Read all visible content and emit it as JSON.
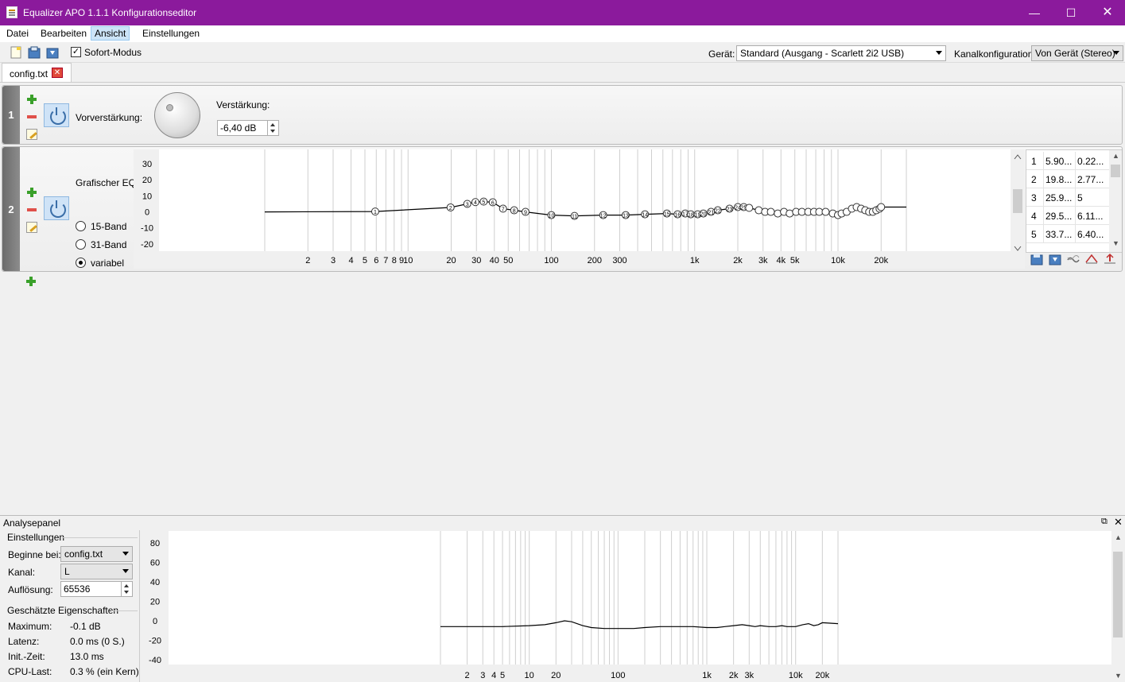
{
  "window": {
    "title": "Equalizer APO 1.1.1 Konfigurationseditor"
  },
  "menu": [
    "Datei",
    "Bearbeiten",
    "Ansicht",
    "Einstellungen"
  ],
  "toolbar": {
    "instant_mode_label": "Sofort-Modus",
    "instant_mode_checked": true,
    "device_label": "Gerät:",
    "device_value": "Standard (Ausgang - Scarlett 2i2 USB)",
    "channel_label": "Kanalkonfiguration:",
    "channel_value": "Von Gerät (Stereo)"
  },
  "tab": {
    "label": "config.txt"
  },
  "block1": {
    "number": "1",
    "preamp_label": "Vorverstärkung:",
    "gain_label": "Verstärkung:",
    "gain_value": "-6,40 dB"
  },
  "block2": {
    "number": "2",
    "eq_label": "Grafischer EQ:",
    "radio": [
      "15-Band",
      "31-Band",
      "variabel"
    ],
    "radio_selected": "variabel",
    "y_ticks": [
      "30",
      "20",
      "10",
      "0",
      "-10",
      "-20"
    ],
    "x_ticks": [
      "2",
      "3",
      "4",
      "5",
      "6",
      "7",
      "8",
      "9",
      "10",
      "20",
      "30",
      "40",
      "50",
      "100",
      "200",
      "300",
      "1k",
      "2k",
      "3k",
      "4k",
      "5k",
      "10k",
      "20k"
    ],
    "table": [
      [
        "1",
        "5.90...",
        "0.22..."
      ],
      [
        "2",
        "19.8...",
        "2.77..."
      ],
      [
        "3",
        "25.9...",
        "5"
      ],
      [
        "4",
        "29.5...",
        "6.11..."
      ],
      [
        "5",
        "33.7...",
        "6.40..."
      ]
    ]
  },
  "analysis": {
    "title": "Analysepanel",
    "settings_title": "Einstellungen",
    "start_label": "Beginne bei:",
    "start_value": "config.txt",
    "channel_label": "Kanal:",
    "channel_value": "L",
    "resolution_label": "Auflösung:",
    "resolution_value": "65536",
    "props_title": "Geschätzte Eigenschaften",
    "props": [
      {
        "label": "Maximum:",
        "value": "-0.1 dB"
      },
      {
        "label": "Latenz:",
        "value": "0.0 ms (0 S.)"
      },
      {
        "label": "Init.-Zeit:",
        "value": "13.0 ms"
      },
      {
        "label": "CPU-Last:",
        "value": "0.3 % (ein Kern)"
      }
    ],
    "y_ticks": [
      "80",
      "60",
      "40",
      "20",
      "0",
      "-20",
      "-40"
    ],
    "x_ticks": [
      "2",
      "3",
      "4",
      "5",
      "10",
      "20",
      "100",
      "1k",
      "2k",
      "3k",
      "10k",
      "20k"
    ]
  },
  "chart_data": [
    {
      "type": "line",
      "title": "",
      "xlabel": "",
      "ylabel": "",
      "x_scale": "log",
      "xlim": [
        1,
        30000
      ],
      "ylim": [
        -25,
        32
      ],
      "band_numbers_visible": [
        "1",
        "2",
        "3",
        "4",
        "5",
        "6",
        "7",
        "8",
        "9",
        "10",
        "11",
        "12",
        "13",
        "14",
        "15",
        "16",
        "17",
        "18",
        "19",
        "20",
        "21",
        "22",
        "23",
        "24",
        "25"
      ],
      "series": [
        {
          "x": [
            1,
            5.9,
            19.8,
            25.9,
            29.5,
            33.7,
            39,
            46,
            55,
            66,
            100,
            145,
            230,
            330,
            450,
            640,
            760,
            860,
            940,
            1050,
            1150,
            1300,
            1450,
            1750,
            2000,
            2200,
            2400,
            2800,
            3100,
            3400,
            3800,
            4200,
            4600,
            5100,
            5600,
            6200,
            6800,
            7400,
            8200,
            9200,
            10000,
            10600,
            11500,
            12500,
            13500,
            14500,
            15500,
            16500,
            17500,
            18500,
            19500,
            20000,
            30000
          ],
          "y": [
            0,
            0.22,
            2.77,
            5,
            6.11,
            6.4,
            6,
            2,
            1,
            0,
            -2,
            -2.5,
            -2,
            -2,
            -1.5,
            -1,
            -1.5,
            -1,
            -1.5,
            -1.5,
            -1,
            0,
            1,
            2,
            3,
            3,
            2.5,
            1,
            0,
            0,
            -1,
            0,
            -1,
            0,
            0,
            0,
            0,
            0,
            0,
            -1,
            -2,
            -1,
            0,
            2,
            3,
            2,
            1,
            0,
            0,
            1,
            2,
            3,
            3
          ]
        }
      ]
    },
    {
      "type": "line",
      "title": "",
      "xlabel": "",
      "ylabel": "",
      "x_scale": "log",
      "xlim": [
        1,
        30000
      ],
      "ylim": [
        -45,
        85
      ],
      "series": [
        {
          "x": [
            1,
            5,
            10,
            15,
            20,
            25,
            30,
            40,
            50,
            70,
            100,
            150,
            200,
            300,
            500,
            700,
            1000,
            1300,
            1600,
            2000,
            2500,
            3000,
            3500,
            4000,
            5000,
            6000,
            7000,
            8000,
            10000,
            12000,
            14000,
            16000,
            18000,
            20000,
            30000
          ],
          "y": [
            -6,
            -6,
            -5,
            -4,
            -2,
            0,
            -1,
            -5,
            -7,
            -8,
            -8,
            -8,
            -7,
            -6,
            -6,
            -6,
            -7,
            -7,
            -6,
            -5,
            -4,
            -5,
            -6,
            -5,
            -6,
            -6,
            -5,
            -6,
            -6,
            -4,
            -3,
            -5,
            -4,
            -2,
            -3
          ]
        }
      ]
    }
  ]
}
